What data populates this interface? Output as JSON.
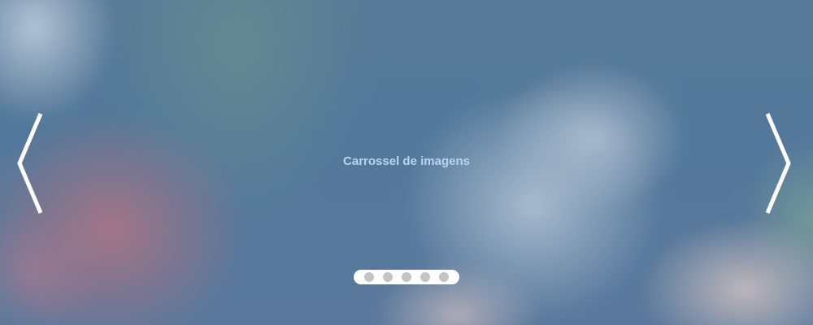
{
  "carousel": {
    "caption": "Carrossel de imagens",
    "prev_icon": "chevron-left-icon",
    "next_icon": "chevron-right-icon",
    "slides_count": 5,
    "indicators": [
      {
        "label": "slide-1"
      },
      {
        "label": "slide-2"
      },
      {
        "label": "slide-3"
      },
      {
        "label": "slide-4"
      },
      {
        "label": "slide-5"
      }
    ]
  },
  "colors": {
    "caption_text": "#b8d4f2",
    "arrow": "#ffffff",
    "indicator_bar": "#ffffff",
    "indicator_dot": "#c4c4c4"
  }
}
